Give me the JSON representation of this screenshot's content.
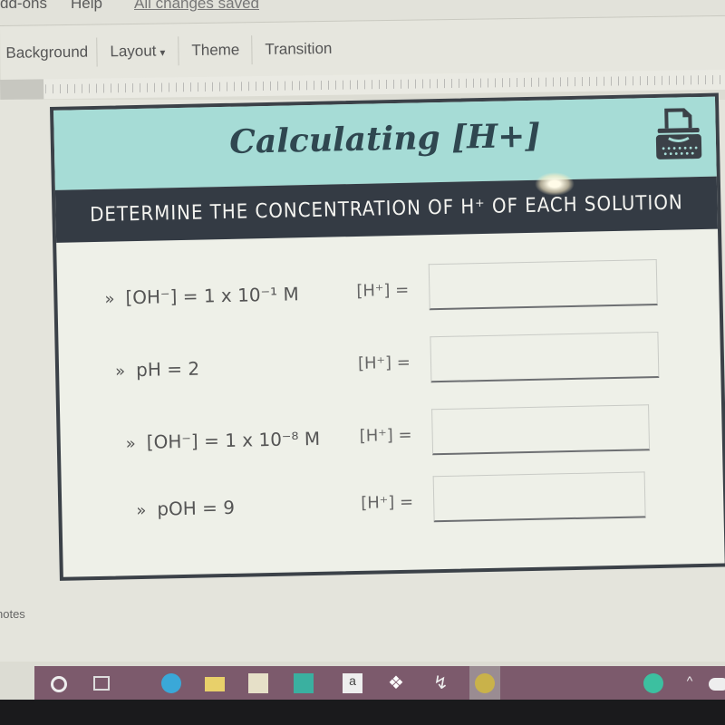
{
  "menu": {
    "items": [
      "dd-ons",
      "Help"
    ],
    "status": "All changes saved"
  },
  "toolbar": {
    "background": "Background",
    "layout": "Layout",
    "theme": "Theme",
    "transition": "Transition"
  },
  "slide": {
    "title": "Calculating [H+]",
    "subtitle": "DETERMINE THE CONCENTRATION OF H⁺ OF EACH SOLUTION",
    "icon": "typewriter-icon",
    "bullet": "»",
    "answer_label": "[H⁺] =",
    "questions": [
      {
        "prompt": "[OH⁻] = 1 x 10⁻¹ M",
        "answer": ""
      },
      {
        "prompt": "pH = 2",
        "answer": ""
      },
      {
        "prompt": "[OH⁻] = 1 x 10⁻⁸ M",
        "answer": ""
      },
      {
        "prompt": "pOH = 9",
        "answer": ""
      }
    ]
  },
  "notes": {
    "label": "notes"
  },
  "taskbar": {
    "icons": [
      "cortana-icon",
      "task-view-icon",
      "edge-icon",
      "file-explorer-icon",
      "store-icon",
      "mail-icon",
      "amazon-icon",
      "dropbox-icon",
      "winamp-icon",
      "chrome-icon",
      "help-icon",
      "chevron-up-icon",
      "cloud-icon"
    ]
  },
  "colors": {
    "header": "#a6dcd6",
    "band": "#343b44",
    "title": "#2f4750",
    "taskbar": "#7c5a6c"
  }
}
